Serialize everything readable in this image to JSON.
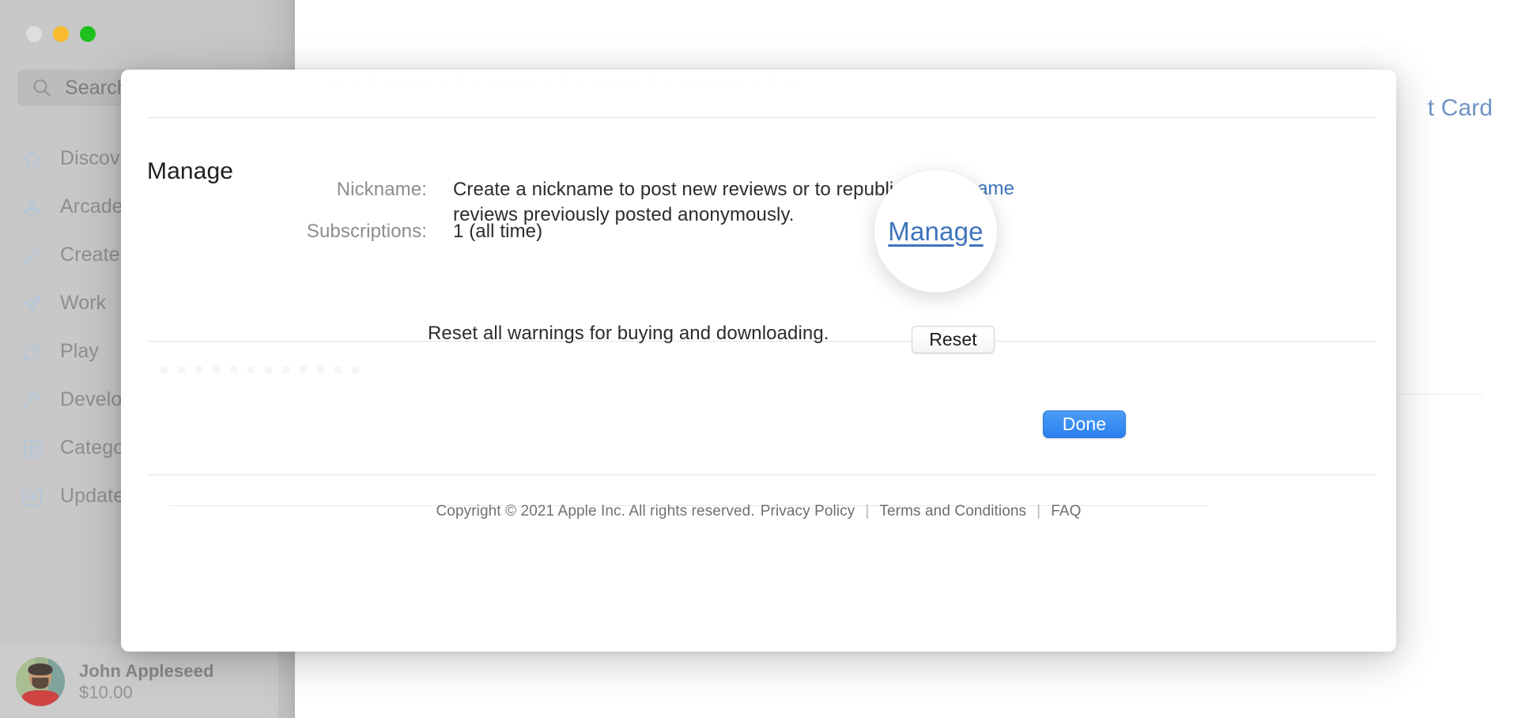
{
  "window": {
    "traffic_lights": [
      "close",
      "minimize",
      "zoom"
    ],
    "search": {
      "placeholder": "Search",
      "icon": "search-icon"
    },
    "sidebar_items": [
      {
        "label": "Discover",
        "icon": "star-icon"
      },
      {
        "label": "Arcade",
        "icon": "joystick-icon"
      },
      {
        "label": "Create",
        "icon": "paintbrush-icon"
      },
      {
        "label": "Work",
        "icon": "paper-plane-icon"
      },
      {
        "label": "Play",
        "icon": "rocket-icon"
      },
      {
        "label": "Develop",
        "icon": "hammer-icon"
      },
      {
        "label": "Categories",
        "icon": "grid-icon"
      },
      {
        "label": "Updates",
        "icon": "download-icon"
      }
    ],
    "account": {
      "name": "John Appleseed",
      "balance": "$10.00",
      "avatar": "user-avatar"
    },
    "gift_card_link": "t Card"
  },
  "sheet": {
    "section_title": "Manage",
    "rows": [
      {
        "label": "Nickname:",
        "value": "Create a nickname to post new reviews or to republish reviews previously posted anonymously.",
        "link": "ickname"
      },
      {
        "label": "Subscriptions:",
        "value": "1 (all time)"
      }
    ],
    "reset": {
      "text": "Reset all warnings for buying and downloading.",
      "button_label": "Reset"
    },
    "done_label": "Done",
    "footer": {
      "copyright": "Copyright © 2021 Apple Inc. All rights reserved.",
      "links": [
        "Privacy Policy",
        "Terms and Conditions",
        "FAQ"
      ],
      "separator": "|"
    }
  },
  "loupe": {
    "magnified_text": "Manage"
  },
  "colors": {
    "accent_blue": "#3e74bb",
    "done_blue": "#3b8ef2",
    "sidebar_gray": "#c8c8c8",
    "text_dark": "#2c2c2c",
    "text_muted": "#8d8d8d"
  }
}
